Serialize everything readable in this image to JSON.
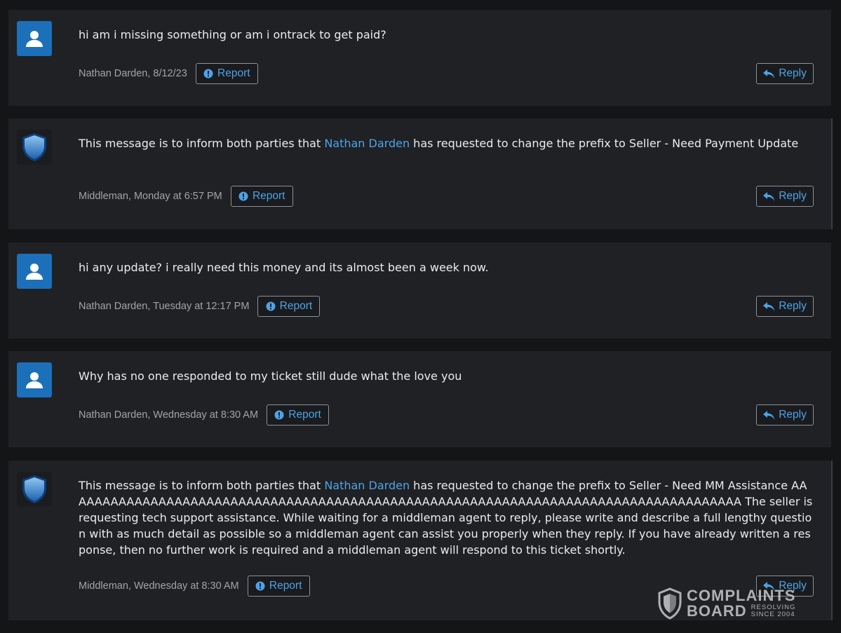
{
  "posts": [
    {
      "avatar": "user-icon",
      "text": "hi am i missing something or am i ontrack to get paid?",
      "meta": "Nathan Darden, 8/12/23",
      "report_label": "Report",
      "reply_label": "Reply"
    },
    {
      "avatar": "shield-icon",
      "text_before": "This message is to inform both parties that ",
      "link": "Nathan Darden",
      "text_after": " has requested to change the prefix to Seller - Need Payment Update",
      "meta": "Middleman, Monday at 6:57 PM",
      "report_label": "Report",
      "reply_label": "Reply"
    },
    {
      "avatar": "user-icon",
      "text": "hi any update? i really need this money and its almost been a week now.",
      "meta": "Nathan Darden, Tuesday at 12:17 PM",
      "report_label": "Report",
      "reply_label": "Reply"
    },
    {
      "avatar": "user-icon",
      "text": "Why has no one responded to my ticket still dude what the love you",
      "meta": "Nathan Darden, Wednesday at 8:30 AM",
      "report_label": "Report",
      "reply_label": "Reply"
    },
    {
      "avatar": "shield-icon",
      "text_before": "This message is to inform both parties that ",
      "link": "Nathan Darden",
      "text_after": " has requested to change the prefix to Seller - Need MM Assistance AAAAAAAAAAAAAAAAAAAAAAAAAAAAAAAAAAAAAAAAAAAAAAAAAAAAAAAAAAAAAAAAAAAAAAAAAAAAAAAAAAAAA The seller is requesting tech support assistance. While waiting for a middleman agent to reply, please write and describe a full lengthy question with as much detail as possible so a middleman agent can assist you properly when they reply. If you have already written a response, then no further work is required and a middleman agent will respond to this ticket shortly.",
      "meta": "Middleman, Wednesday at 8:30 AM",
      "report_label": "Report",
      "reply_label": "Reply"
    }
  ],
  "watermark": {
    "line1": "COMPLAINTS",
    "line2": "BOARD",
    "tag1": "RESOLVING",
    "tag2": "SINCE 2004"
  },
  "colors": {
    "link": "#4da3e8",
    "avatar_bg": "#1c6fb9",
    "post_bg": "#202124",
    "page_bg": "#141517"
  }
}
